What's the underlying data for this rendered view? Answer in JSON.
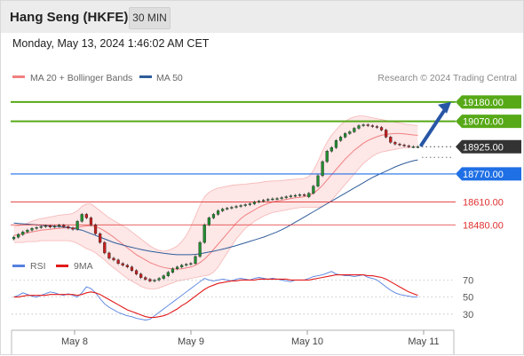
{
  "header": {
    "title": "Hang Seng (HKFE)",
    "timeframe": "30 MIN"
  },
  "datetime": "Monday, May 13, 2024 1:46:02 AM CET",
  "colors": {
    "bollinger": "#f08080",
    "ma50": "#2e5c9a",
    "support": "#1f6fe5",
    "resistance": "#57a917",
    "red_level": "#e03030",
    "current": "#333333",
    "up_candle": "#1f8f2f",
    "down_candle": "#c81e1e",
    "rsi": "#5580e0",
    "rsi_ma": "#e21a1a",
    "arrow": "#2856a6"
  },
  "chart_data": [
    {
      "type": "candlestick",
      "legend": [
        {
          "name": "MA 20 + Bollinger Bands",
          "color": "#f08080"
        },
        {
          "name": "MA 50",
          "color": "#2e5c9a"
        }
      ],
      "source": "Research © 2024 Trading Central",
      "x_tick_labels": [
        "May 8",
        "May 9",
        "May 10",
        "May 11"
      ],
      "ylim": [
        18350,
        19260
      ],
      "close": [
        18410,
        18425,
        18440,
        18450,
        18460,
        18465,
        18470,
        18475,
        18468,
        18472,
        18478,
        18470,
        18462,
        18455,
        18500,
        18540,
        18520,
        18480,
        18430,
        18380,
        18320,
        18290,
        18280,
        18260,
        18250,
        18240,
        18220,
        18200,
        18180,
        18170,
        18160,
        18165,
        18175,
        18190,
        18210,
        18230,
        18240,
        18250,
        18255,
        18260,
        18300,
        18380,
        18480,
        18520,
        18540,
        18560,
        18570,
        18575,
        18580,
        18585,
        18590,
        18595,
        18600,
        18610,
        18615,
        18620,
        18625,
        18628,
        18630,
        18635,
        18640,
        18645,
        18648,
        18652,
        18650,
        18660,
        18700,
        18760,
        18840,
        18900,
        18920,
        18960,
        18980,
        19000,
        19010,
        19030,
        19045,
        19050,
        19045,
        19040,
        19035,
        19020,
        18980,
        18950,
        18940,
        18935,
        18930,
        18925,
        18925,
        18925
      ],
      "open": [
        18400,
        18410,
        18425,
        18440,
        18450,
        18460,
        18465,
        18470,
        18475,
        18468,
        18472,
        18478,
        18470,
        18462,
        18455,
        18500,
        18540,
        18520,
        18480,
        18430,
        18380,
        18320,
        18290,
        18280,
        18260,
        18250,
        18240,
        18220,
        18200,
        18180,
        18170,
        18160,
        18165,
        18175,
        18190,
        18210,
        18230,
        18240,
        18250,
        18255,
        18260,
        18300,
        18380,
        18480,
        18520,
        18540,
        18560,
        18570,
        18575,
        18580,
        18585,
        18590,
        18595,
        18600,
        18610,
        18615,
        18620,
        18625,
        18628,
        18630,
        18635,
        18640,
        18645,
        18648,
        18652,
        18640,
        18660,
        18700,
        18760,
        18840,
        18900,
        18920,
        18960,
        18980,
        19000,
        19010,
        19030,
        19045,
        19050,
        19045,
        19040,
        19035,
        19020,
        18980,
        18950,
        18940,
        18935,
        18930,
        18925,
        18925
      ],
      "ma20_bollinger": {
        "middle": [
          18420,
          18425,
          18430,
          18435,
          18440,
          18445,
          18450,
          18452,
          18455,
          18458,
          18460,
          18462,
          18463,
          18462,
          18465,
          18470,
          18474,
          18475,
          18470,
          18460,
          18445,
          18428,
          18410,
          18390,
          18370,
          18350,
          18330,
          18310,
          18295,
          18280,
          18265,
          18255,
          18245,
          18238,
          18232,
          18230,
          18228,
          18230,
          18235,
          18240,
          18250,
          18265,
          18285,
          18310,
          18340,
          18370,
          18400,
          18430,
          18460,
          18490,
          18515,
          18535,
          18550,
          18565,
          18580,
          18592,
          18602,
          18610,
          18616,
          18620,
          18625,
          18630,
          18634,
          18637,
          18640,
          18648,
          18660,
          18680,
          18705,
          18735,
          18765,
          18795,
          18825,
          18855,
          18880,
          18905,
          18925,
          18945,
          18960,
          18972,
          18982,
          18990,
          18995,
          18998,
          19000,
          19000,
          18998,
          18995,
          18992,
          18990
        ],
        "upper": [
          18470,
          18475,
          18480,
          18490,
          18500,
          18510,
          18515,
          18520,
          18525,
          18530,
          18535,
          18538,
          18540,
          18545,
          18560,
          18585,
          18600,
          18600,
          18580,
          18560,
          18540,
          18520,
          18505,
          18490,
          18475,
          18460,
          18440,
          18420,
          18400,
          18380,
          18360,
          18345,
          18335,
          18330,
          18335,
          18345,
          18360,
          18385,
          18420,
          18470,
          18530,
          18590,
          18640,
          18665,
          18680,
          18690,
          18695,
          18700,
          18705,
          18708,
          18710,
          18712,
          18715,
          18718,
          18720,
          18725,
          18728,
          18730,
          18730,
          18732,
          18735,
          18738,
          18740,
          18742,
          18745,
          18755,
          18790,
          18840,
          18900,
          18950,
          18990,
          19020,
          19050,
          19070,
          19085,
          19095,
          19100,
          19100,
          19095,
          19090,
          19085,
          19080,
          19075,
          19070,
          19065,
          19060,
          19055,
          19050,
          19048,
          19045
        ],
        "lower": [
          18380,
          18380,
          18380,
          18385,
          18385,
          18385,
          18390,
          18390,
          18390,
          18390,
          18390,
          18390,
          18390,
          18385,
          18375,
          18360,
          18345,
          18335,
          18320,
          18300,
          18280,
          18255,
          18235,
          18215,
          18195,
          18175,
          18160,
          18145,
          18130,
          18120,
          18115,
          18115,
          18120,
          18130,
          18140,
          18150,
          18160,
          18165,
          18170,
          18175,
          18180,
          18185,
          18190,
          18195,
          18210,
          18240,
          18280,
          18320,
          18360,
          18400,
          18430,
          18460,
          18480,
          18500,
          18515,
          18530,
          18540,
          18550,
          18555,
          18560,
          18565,
          18570,
          18575,
          18578,
          18580,
          18580,
          18580,
          18580,
          18585,
          18600,
          18620,
          18650,
          18680,
          18710,
          18740,
          18770,
          18800,
          18830,
          18850,
          18870,
          18885,
          18895,
          18900,
          18905,
          18910,
          18915,
          18918,
          18920,
          18922,
          18925
        ]
      },
      "ma50": [
        18490,
        18488,
        18486,
        18484,
        18482,
        18480,
        18478,
        18476,
        18474,
        18472,
        18470,
        18468,
        18465,
        18460,
        18455,
        18450,
        18440,
        18430,
        18420,
        18410,
        18400,
        18390,
        18380,
        18372,
        18365,
        18358,
        18352,
        18346,
        18340,
        18335,
        18330,
        18326,
        18322,
        18318,
        18315,
        18312,
        18310,
        18310,
        18310,
        18310,
        18312,
        18315,
        18320,
        18325,
        18330,
        18336,
        18342,
        18348,
        18355,
        18362,
        18370,
        18378,
        18386,
        18394,
        18402,
        18410,
        18420,
        18430,
        18440,
        18452,
        18465,
        18480,
        18495,
        18510,
        18525,
        18540,
        18555,
        18570,
        18585,
        18600,
        18615,
        18630,
        18645,
        18660,
        18675,
        18690,
        18705,
        18720,
        18735,
        18750,
        18762,
        18774,
        18786,
        18798,
        18810,
        18820,
        18830,
        18838,
        18845,
        18850
      ],
      "levels": [
        {
          "label": "19180.00",
          "value": 19180,
          "kind": "resistance"
        },
        {
          "label": "19070.00",
          "value": 19070,
          "kind": "resistance"
        },
        {
          "label": "18925.00",
          "value": 18925,
          "kind": "current"
        },
        {
          "label": "18770.00",
          "value": 18770,
          "kind": "support"
        },
        {
          "label": "18610.00",
          "value": 18610,
          "kind": "red"
        },
        {
          "label": "18480.00",
          "value": 18480,
          "kind": "red"
        }
      ],
      "arrow_target": 19180
    },
    {
      "type": "line",
      "legend": [
        {
          "name": "RSI",
          "color": "#5580e0"
        },
        {
          "name": "9MA",
          "color": "#e21a1a"
        }
      ],
      "ylim": [
        10,
        85
      ],
      "y_tick_labels": [
        "70",
        "50",
        "30"
      ],
      "rsi": [
        50,
        52,
        55,
        53,
        51,
        50,
        52,
        54,
        56,
        55,
        53,
        52,
        54,
        52,
        50,
        55,
        62,
        60,
        55,
        48,
        42,
        38,
        35,
        32,
        30,
        28,
        27,
        25,
        24,
        23,
        24,
        28,
        32,
        36,
        40,
        44,
        48,
        52,
        56,
        60,
        64,
        68,
        72,
        70,
        69,
        70,
        71,
        70,
        69,
        71,
        72,
        71,
        70,
        72,
        73,
        72,
        71,
        72,
        71,
        70,
        69,
        68,
        70,
        70,
        70,
        72,
        74,
        75,
        76,
        78,
        80,
        77,
        76,
        75,
        75,
        74,
        75,
        76,
        73,
        72,
        70,
        66,
        62,
        58,
        55,
        53,
        52,
        51,
        50,
        50
      ],
      "rsi_ma": [
        50,
        50,
        51,
        52,
        52,
        52,
        52,
        52,
        53,
        53,
        53,
        53,
        53,
        53,
        52,
        53,
        55,
        56,
        55,
        53,
        50,
        47,
        44,
        41,
        38,
        35,
        33,
        31,
        29,
        27,
        26,
        26,
        27,
        28,
        30,
        33,
        36,
        40,
        43,
        47,
        51,
        55,
        59,
        62,
        64,
        66,
        67,
        68,
        69,
        69,
        70,
        70,
        70,
        70,
        71,
        71,
        71,
        71,
        71,
        71,
        71,
        70,
        70,
        70,
        70,
        70,
        71,
        72,
        73,
        74,
        75,
        76,
        76,
        76,
        76,
        76,
        76,
        76,
        75,
        75,
        74,
        73,
        71,
        68,
        65,
        62,
        59,
        56,
        54,
        52
      ]
    }
  ]
}
